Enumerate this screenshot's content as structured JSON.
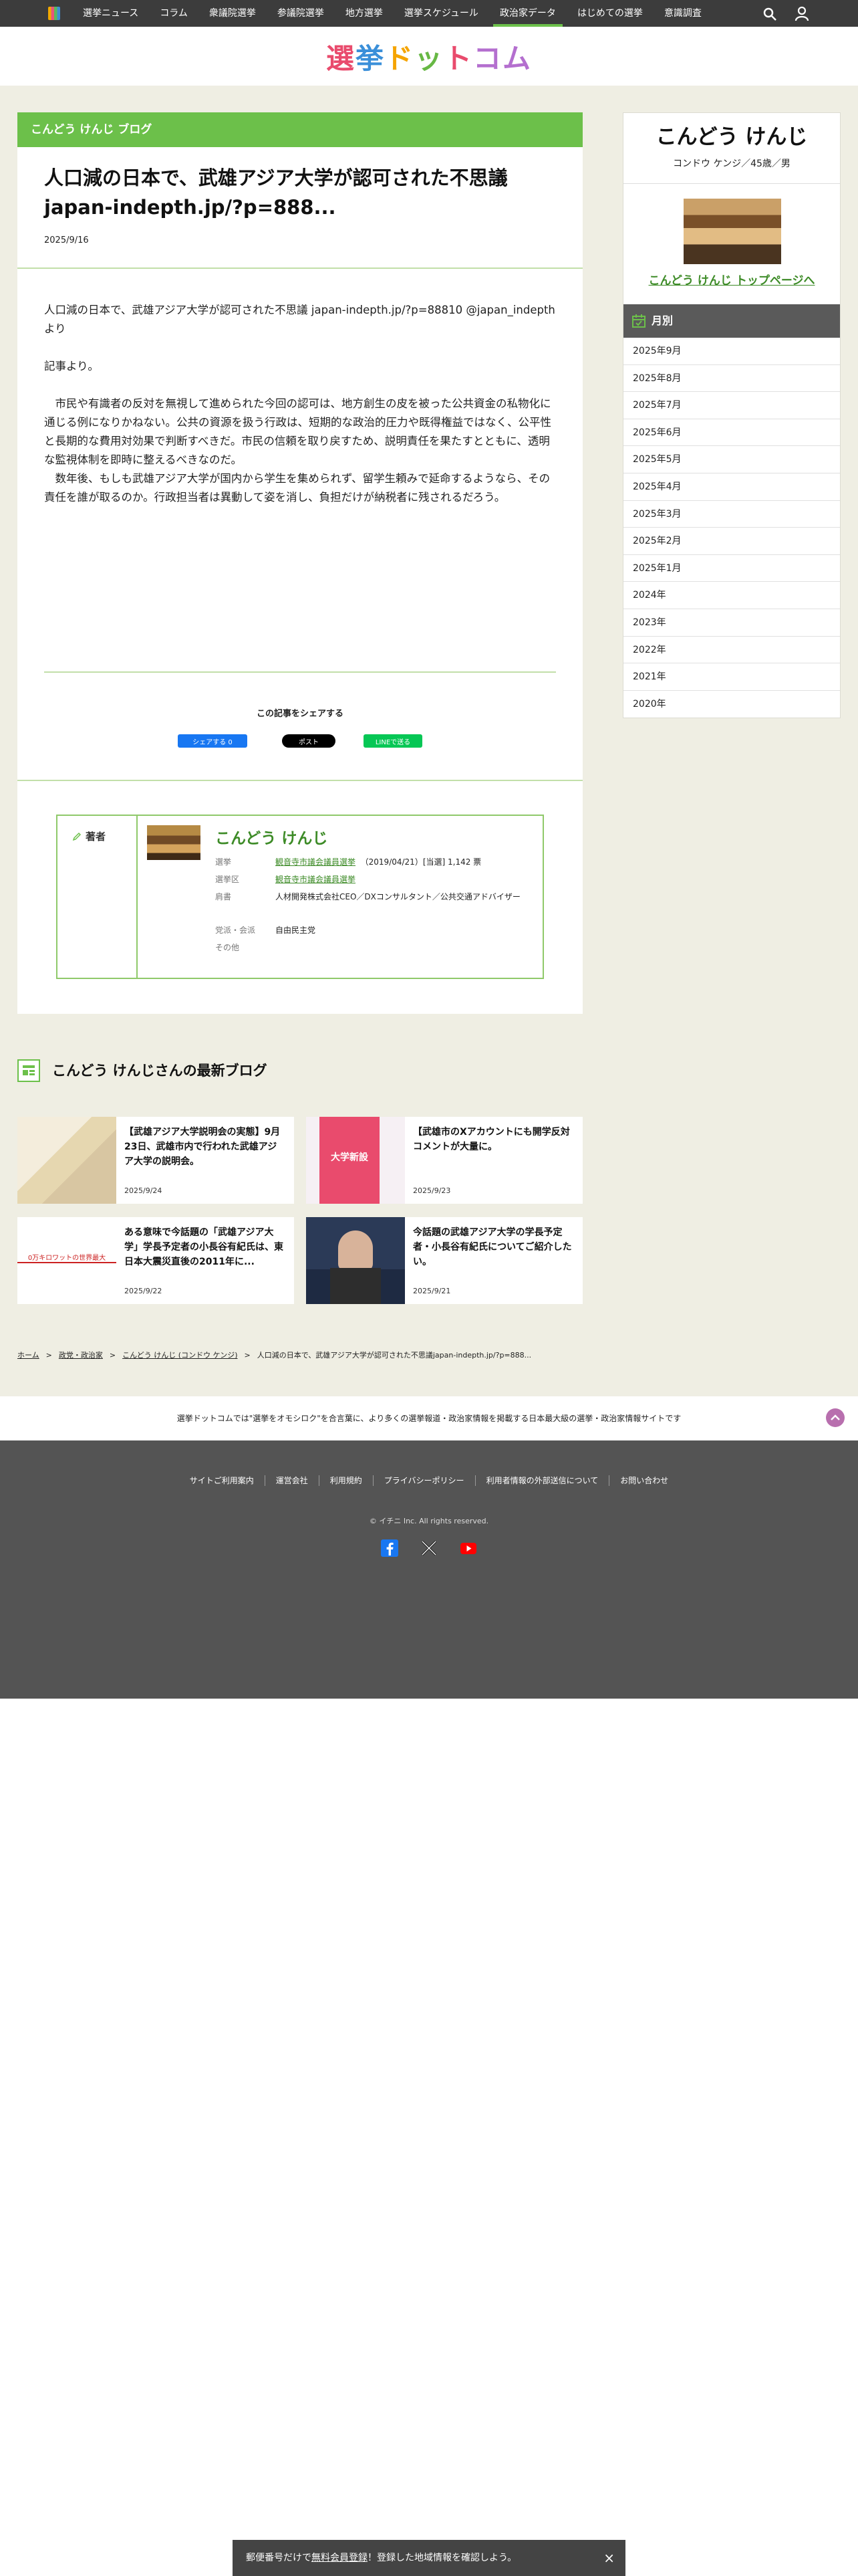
{
  "nav": {
    "items": [
      "選挙ニュース",
      "コラム",
      "衆議院選挙",
      "参議院選挙",
      "地方選挙",
      "選挙スケジュール",
      "政治家データ",
      "はじめての選挙",
      "意識調査"
    ],
    "active_index": 6
  },
  "brand": {
    "chars": [
      "選",
      "挙",
      "ド",
      "ッ",
      "ト",
      "コム"
    ]
  },
  "article": {
    "section_label": "こんどう けんじ ブログ",
    "title": "人口減の日本で、武雄アジア大学が認可された不思議 japan-indepth.jp/?p=888...",
    "date": "2025/9/16",
    "p1": "人口減の日本で、武雄アジア大学が認可された不思議 japan-indepth.jp/?p=88810 @japan_indepthより",
    "p2": "記事より。",
    "p3": "　市民や有識者の反対を無視して進められた今回の認可は、地方創生の皮を被った公共資金の私物化に通じる例になりかねない。公共の資源を扱う行政は、短期的な政治的圧力や既得権益ではなく、公平性と長期的な費用対効果で判断すべきだ。市民の信頼を取り戻すため、説明責任を果たすとともに、透明な監視体制を即時に整えるべきなのだ。\n　数年後、もしも武雄アジア大学が国内から学生を集められず、留学生頼みで延命するようなら、その責任を誰が取るのか。行政担当者は異動して姿を消し、負担だけが納税者に残されるだろう。",
    "share_title": "この記事をシェアする",
    "share_fb": "シェアする 0",
    "share_x": "ポスト",
    "share_line": "LINEで送る"
  },
  "author": {
    "label": "著者",
    "name": "こんどう けんじ",
    "rows": [
      {
        "k": "選挙",
        "v_link": "観音寺市議会議員選挙",
        "v_text": "（2019/04/21）[当選] 1,142 票"
      },
      {
        "k": "選挙区",
        "v_link": "観音寺市議会議員選挙",
        "v_text": ""
      },
      {
        "k": "肩書",
        "v_link": "",
        "v_text": "人材開発株式会社CEO／DXコンサルタント／公共交通アドバイザー"
      },
      {
        "k": "党派・会派",
        "v_link": "",
        "v_text": "自由民主党"
      },
      {
        "k": "その他",
        "v_link": "",
        "v_text": ""
      }
    ]
  },
  "sidebar": {
    "name": "こんどう けんじ",
    "kana": "コンドウ ケンジ／45歳／男",
    "top_link": "こんどう けんじ トップページへ",
    "monthly_label": "月別",
    "months": [
      "2025年9月",
      "2025年8月",
      "2025年7月",
      "2025年6月",
      "2025年5月",
      "2025年4月",
      "2025年3月",
      "2025年2月",
      "2025年1月",
      "2024年",
      "2023年",
      "2022年",
      "2021年",
      "2020年"
    ]
  },
  "latest": {
    "title": "こんどう けんじさんの最新ブログ",
    "posts": [
      {
        "title": "【武雄アジア大学説明会の実態】9月23日、武雄市内で行われた武雄アジア大学の説明会。",
        "date": "2025/9/24",
        "thumb_text": ""
      },
      {
        "title": "【武雄市のXアカウントにも開学反対コメントが大量に。",
        "date": "2025/9/23",
        "thumb_text": "大学新設"
      },
      {
        "title": "ある意味で今話題の「武雄アジア大学」学長予定者の小長谷有紀氏は、東日本大震災直後の2011年に...",
        "date": "2025/9/22",
        "thumb_text": "0万キロワットの世界最大"
      },
      {
        "title": "今話題の武雄アジア大学の学長予定者・小長谷有紀氏についてご紹介したい。",
        "date": "2025/9/21",
        "thumb_text": ""
      }
    ]
  },
  "breadcrumb": {
    "items": [
      "ホーム",
      "政党・政治家",
      "こんどう けんじ (コンドウ ケンジ)"
    ],
    "current": "人口減の日本で、武雄アジア大学が認可された不思議japan-indepth.jp/?p=888..."
  },
  "footer": {
    "message": "選挙ドットコムでは\"選挙をオモシロク\"を合言葉に、より多くの選挙報道・政治家情報を掲載する日本最大級の選挙・政治家情報サイトです",
    "links": [
      "サイトご利用案内",
      "運営会社",
      "利用規約",
      "プライバシーポリシー",
      "利用者情報の外部送信について",
      "お問い合わせ"
    ],
    "copyright": "© イチニ Inc. All rights reserved."
  },
  "register_bar": {
    "prefix": "郵便番号だけで",
    "link": "無料会員登録",
    "suffix": "！登録した地域情報を確認しよう。",
    "close": "×"
  },
  "colors": {
    "accent": "#6cc04a",
    "link": "#3d8b27",
    "nav_bg": "#3c3c3c",
    "footer_bg": "#545454"
  }
}
